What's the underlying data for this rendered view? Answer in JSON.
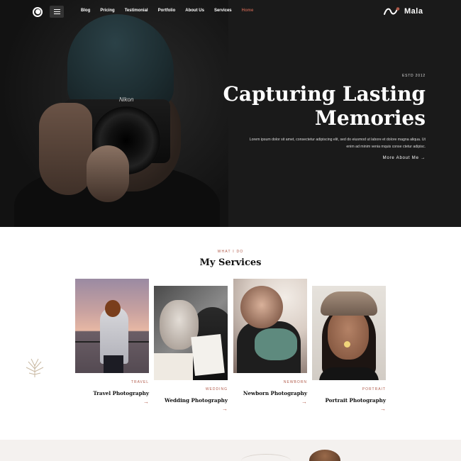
{
  "nav": {
    "menu_icon": "hamburger-icon",
    "links": [
      {
        "label": "Blog",
        "active": false
      },
      {
        "label": "Pricing",
        "active": false
      },
      {
        "label": "Testimonial",
        "active": false
      },
      {
        "label": "Portfolio",
        "active": false
      },
      {
        "label": "About Us",
        "active": false
      },
      {
        "label": "Services",
        "active": false
      },
      {
        "label": "Home",
        "active": true
      }
    ],
    "brand_name": "Mala",
    "accent_color": "#b05a4a"
  },
  "hero": {
    "estd": "ESTD 2012",
    "title_line1": "Capturing Lasting",
    "title_line2": "Memories",
    "description": "Lorem ipsum dolor sit amet, consectetur adipiscing elit, sed do eiusmod ut labore et dolore magna aliqua. Ut enim ad minim venia mquis conse ctetur adipisc.",
    "more_label": "More About Me →",
    "photo_brand": "Nikon"
  },
  "services": {
    "eyebrow": "WHAT I DO",
    "title": "My Services",
    "items": [
      {
        "category": "TRAVEL",
        "title": "Travel Photography",
        "arrow": "→"
      },
      {
        "category": "WEDDING",
        "title": "Wedding Photography",
        "arrow": "→"
      },
      {
        "category": "NEWBORN",
        "title": "Newborn Photography",
        "arrow": "→"
      },
      {
        "category": "PORTRAIT",
        "title": "Portrait Photography",
        "arrow": "→"
      }
    ]
  }
}
